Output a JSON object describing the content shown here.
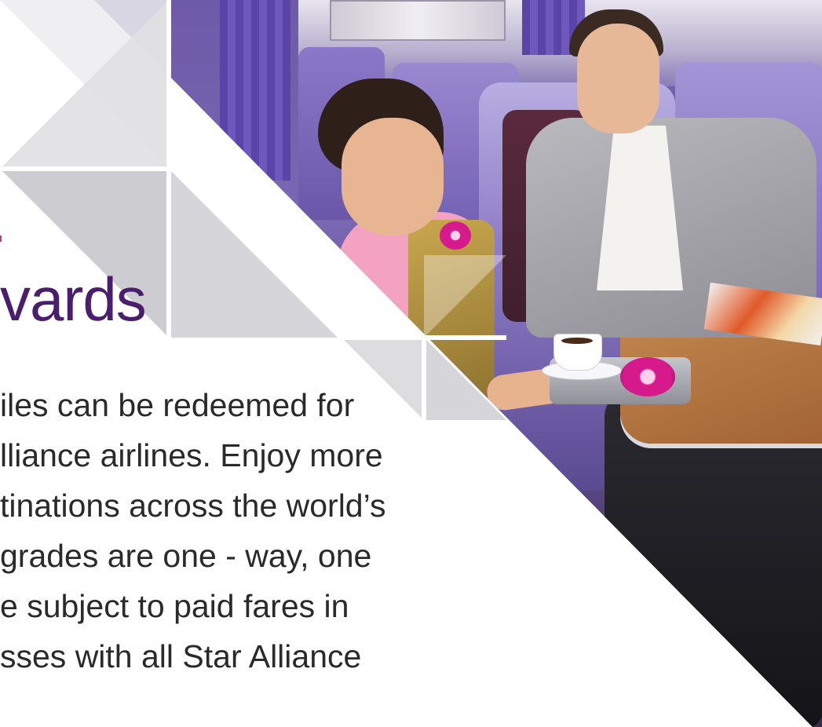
{
  "document": {
    "heading": "vards",
    "body_lines": [
      "iles can be redeemed for",
      "lliance airlines. Enjoy more",
      "tinations across the world’s",
      "grades are one - way, one",
      "e subject to paid fares in",
      "sses with all Star Alliance"
    ]
  },
  "colors": {
    "heading": "#4b1e6d",
    "body_text": "#2a2a2a",
    "accent_dot": "#c33d7c",
    "triangles_light": "#d9d9dc",
    "triangles_mid": "#c9c9cd"
  },
  "photo": {
    "subject": "cabin-crew-serving-passenger"
  }
}
